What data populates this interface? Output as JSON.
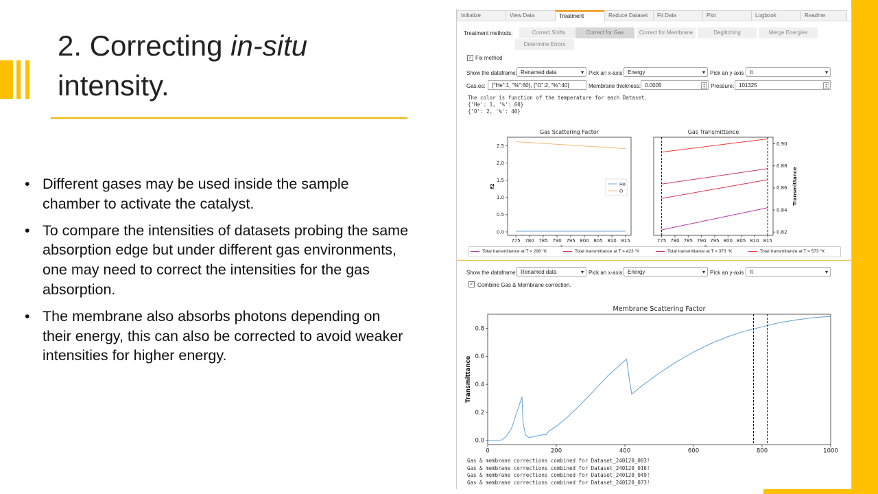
{
  "slide": {
    "title_plain": "2. Correcting ",
    "title_italic": "in-situ",
    "title_line2": "intensity.",
    "bullets": [
      "Different gases may be used inside the sample chamber to activate the catalyst.",
      "To compare the intensities of datasets probing the same absorption edge but under different gas environments, one may need to correct the intensities for the gas absorption.",
      "The membrane also absorbs photons depending on their energy, this can also be corrected to avoid  weaker intensities for higher energy."
    ],
    "accent_color": "#ffc000"
  },
  "app": {
    "tabs": [
      "Initialize",
      "View Data",
      "Treatment",
      "Reduce Dataset",
      "Fit Data",
      "Plot",
      "Logbook",
      "Readme"
    ],
    "active_tab": "Treatment",
    "treatment_label": "Treatment methods:",
    "methods": [
      "Correct Shifts",
      "Correct for Gas",
      "Correct for Membrane",
      "Deglitching",
      "Merge Energies",
      "Determine Errors"
    ],
    "selected_method": "Correct for Gas",
    "fix_method": {
      "checked": true,
      "label": "Fix method",
      "mark": "✓"
    },
    "gas_panel": {
      "show_df_label": "Show the dataframe:",
      "show_df_value": "Renamed data",
      "x_label": "Pick an x-axis",
      "x_value": "Energy",
      "y_label": "Pick an y-axis",
      "y_value": "It",
      "gases_label": "Gas.es:",
      "gases_value": "{\"He\":1, \"%\":60}, {\"O\":2, \"%\":40}",
      "membrane_label": "Membrane thickness:",
      "membrane_value": "0.0005",
      "pressure_label": "Pressure:",
      "pressure_value": "101325",
      "output_lines": [
        "The color is function of the temperature for each Dataset.",
        "{'He': 1, '%': 60}",
        "{'O': 2, '%': 40}"
      ]
    },
    "membrane_panel": {
      "show_df_label": "Show the dataframe:",
      "show_df_value": "Renamed data",
      "x_label": "Pick an x-axis",
      "x_value": "Energy",
      "y_label": "Pick an y-axis",
      "y_value": "It",
      "combine": {
        "checked": true,
        "label": "Combine Gas & Membrane correction.",
        "mark": "✓"
      },
      "output_lines": [
        "Gas & membrane corrections combined for Dataset_240120_003!",
        "Gas & membrane corrections combined for Dataset_240120_016!",
        "Gas & membrane corrections combined for Dataset_240120_049!",
        "Gas & membrane corrections combined for Dataset_240120_073!"
      ]
    }
  },
  "chart_data": [
    {
      "type": "line",
      "title": "Gas Scattering Factor",
      "xlabel": "Energy",
      "ylabel": "f2",
      "xlim": [
        772,
        817
      ],
      "ylim": [
        -0.1,
        2.75
      ],
      "xticks": [
        775,
        780,
        785,
        790,
        795,
        800,
        805,
        810,
        815
      ],
      "yticks": [
        0.0,
        0.5,
        1.0,
        1.5,
        2.0,
        2.5
      ],
      "ytick_labels": [
        "0.0",
        "0.5",
        "1.0",
        "1.5",
        "2.0",
        "2.5"
      ],
      "legend": "center-right",
      "series": [
        {
          "name": "He",
          "color": "#6fa7d4",
          "x": [
            775,
            815
          ],
          "y": [
            0.02,
            0.02
          ]
        },
        {
          "name": "O",
          "color": "#f5b77a",
          "x": [
            775,
            815
          ],
          "y": [
            2.62,
            2.42
          ]
        }
      ]
    },
    {
      "type": "line",
      "title": "Gas Transmittance",
      "xlabel": "Energy",
      "ylabel": "Transmittance",
      "y_axis_side": "right",
      "xlim": [
        772,
        817
      ],
      "ylim": [
        0.817,
        0.906
      ],
      "xticks": [
        775,
        780,
        785,
        790,
        795,
        800,
        805,
        810,
        815
      ],
      "yticks": [
        0.82,
        0.84,
        0.86,
        0.88,
        0.9
      ],
      "ytick_labels": [
        "0.82",
        "0.84",
        "0.86",
        "0.88",
        "0.90"
      ],
      "vlines": [
        775,
        815
      ],
      "series": [
        {
          "name": "Total transmittance at T =  298 °K",
          "color": "#b03aa0",
          "x": [
            775,
            815
          ],
          "y": [
            0.822,
            0.842
          ]
        },
        {
          "name": "Total transmittance at T =  423 °K",
          "color": "#d9344f",
          "x": [
            775,
            815
          ],
          "y": [
            0.8505,
            0.8675
          ]
        },
        {
          "name": "Total transmittance at T =  373 °K",
          "color": "#c8366b",
          "x": [
            775,
            815
          ],
          "y": [
            0.8635,
            0.8775
          ]
        },
        {
          "name": "Total transmittance at T =  573 °K",
          "color": "#ee3a3a",
          "x": [
            775,
            815
          ],
          "y": [
            0.8925,
            0.9045
          ]
        }
      ]
    },
    {
      "type": "line",
      "title": "Membrane Scattering Factor",
      "xlabel": "Energy",
      "ylabel": "Transmittance",
      "xlim": [
        0,
        1000
      ],
      "ylim": [
        -0.03,
        0.9
      ],
      "xticks": [
        0,
        200,
        400,
        600,
        800,
        1000
      ],
      "yticks": [
        0.0,
        0.2,
        0.4,
        0.6,
        0.8
      ],
      "ytick_labels": [
        "0.0",
        "0.2",
        "0.4",
        "0.6",
        "0.8"
      ],
      "vlines": [
        775,
        815
      ],
      "series": [
        {
          "color": "#6fa7d4",
          "x": [
            0,
            20,
            40,
            55,
            70,
            85,
            100,
            103,
            110,
            120,
            140,
            160,
            170,
            180,
            200,
            230,
            260,
            300,
            350,
            400,
            405,
            412,
            420,
            450,
            500,
            550,
            600,
            650,
            700,
            750,
            800,
            850,
            900,
            950,
            1000
          ],
          "y": [
            0.0,
            0.0,
            0.002,
            0.03,
            0.09,
            0.2,
            0.31,
            0.13,
            0.04,
            0.02,
            0.03,
            0.04,
            0.04,
            0.07,
            0.1,
            0.16,
            0.23,
            0.33,
            0.46,
            0.57,
            0.58,
            0.45,
            0.33,
            0.39,
            0.48,
            0.56,
            0.63,
            0.69,
            0.74,
            0.78,
            0.81,
            0.84,
            0.86,
            0.875,
            0.885
          ]
        }
      ]
    }
  ]
}
